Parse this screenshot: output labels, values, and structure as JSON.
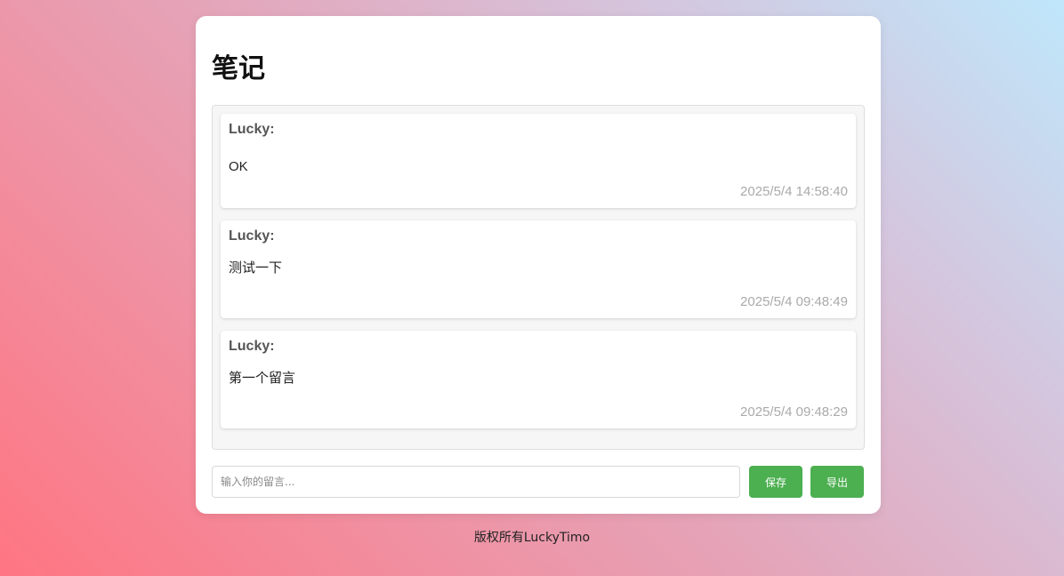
{
  "page": {
    "title": "笔记"
  },
  "messages": [
    {
      "author": "Lucky:",
      "text": "OK",
      "time": "2025/5/4 14:58:40"
    },
    {
      "author": "Lucky:",
      "text": "测试一下",
      "time": "2025/5/4 09:48:49"
    },
    {
      "author": "Lucky:",
      "text": "第一个留言",
      "time": "2025/5/4 09:48:29"
    }
  ],
  "composer": {
    "placeholder": "输入你的留言...",
    "value": "",
    "save_label": "保存",
    "export_label": "导出"
  },
  "footer": {
    "text": "版权所有LuckyTimo"
  },
  "colors": {
    "button": "#4caf50",
    "card": "#ffffff",
    "list_background": "#f6f6f6"
  }
}
